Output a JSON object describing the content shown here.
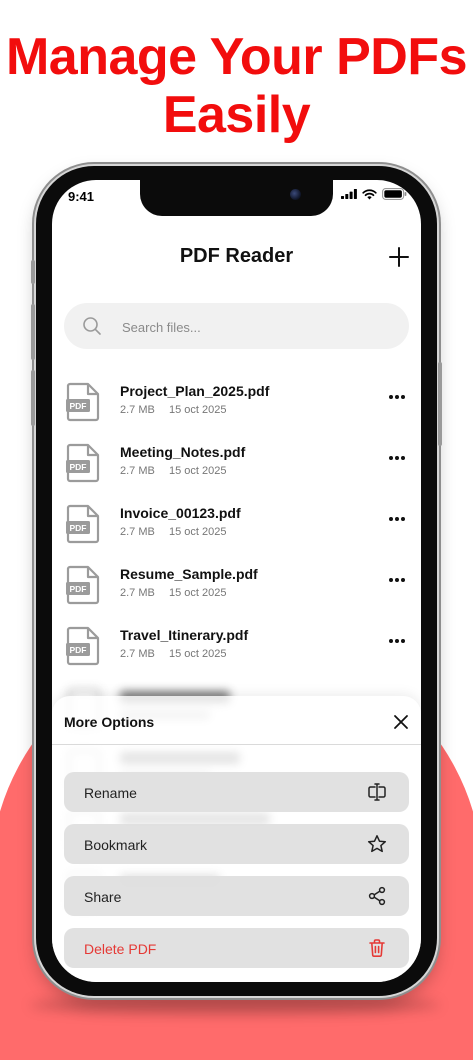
{
  "headline": {
    "line1": "Manage Your PDFs",
    "line2": "Easily"
  },
  "status_bar": {
    "time": "9:41"
  },
  "app": {
    "title": "PDF Reader",
    "search": {
      "placeholder": "Search files..."
    },
    "file_badge": "PDF",
    "files": [
      {
        "name": "Project_Plan_2025.pdf",
        "size": "2.7 MB",
        "date": "15 oct 2025"
      },
      {
        "name": "Meeting_Notes.pdf",
        "size": "2.7 MB",
        "date": "15 oct 2025"
      },
      {
        "name": "Invoice_00123.pdf",
        "size": "2.7 MB",
        "date": "15 oct 2025"
      },
      {
        "name": "Resume_Sample.pdf",
        "size": "2.7 MB",
        "date": "15 oct 2025"
      },
      {
        "name": "Travel_Itinerary.pdf",
        "size": "2.7 MB",
        "date": "15 oct 2025"
      }
    ]
  },
  "sheet": {
    "title": "More Options",
    "options": [
      {
        "label": "Rename",
        "icon": "rename-icon"
      },
      {
        "label": "Bookmark",
        "icon": "star-icon"
      },
      {
        "label": "Share",
        "icon": "share-icon"
      },
      {
        "label": "Delete PDF",
        "icon": "trash-icon"
      }
    ]
  },
  "colors": {
    "headline": "#f20d0d",
    "background_accent": "#ff6b6b",
    "danger": "#e53935",
    "sheet_button": "#dedede"
  }
}
